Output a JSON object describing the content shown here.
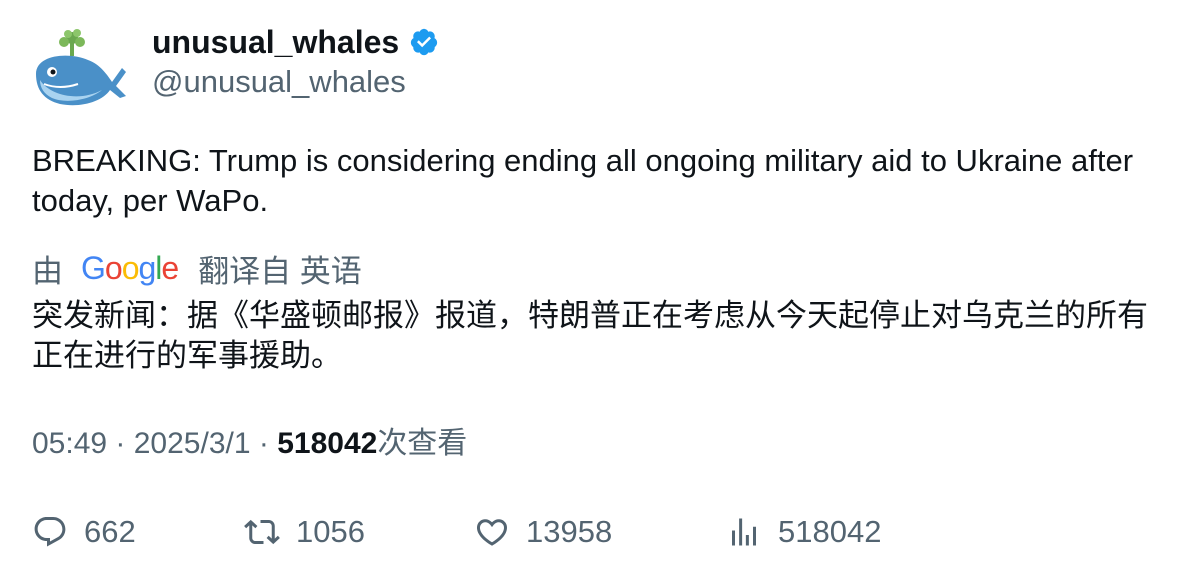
{
  "author": {
    "display_name": "unusual_whales",
    "handle": "@unusual_whales",
    "verified_icon": "verified-badge-icon",
    "verified_color": "#1d9bf0",
    "avatar_icon": "whale-avatar-icon"
  },
  "tweet": {
    "text": "BREAKING: Trump is considering ending all ongoing military aid to Ukraine after today, per WaPo."
  },
  "translation": {
    "by_label": "由",
    "provider": "Google",
    "suffix_label": "翻译自 英语",
    "text": "突发新闻：据《华盛顿邮报》报道，特朗普正在考虑从今天起停止对乌克兰的所有正在进行的军事援助。"
  },
  "meta": {
    "time": "05:49",
    "separator": " · ",
    "date": "2025/3/1",
    "views_count": "518042",
    "views_label": "次查看"
  },
  "actions": {
    "replies": "662",
    "retweets": "1056",
    "likes": "13958",
    "views": "518042"
  },
  "colors": {
    "text_primary": "#0f1419",
    "text_secondary": "#536471",
    "whale_blue": "#4a90c8"
  }
}
